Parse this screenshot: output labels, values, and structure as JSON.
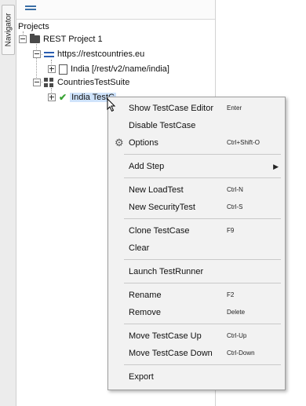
{
  "navigator": {
    "tab_label": "Navigator"
  },
  "tree": {
    "root_label": "Projects",
    "project": "REST Project 1",
    "service": "https://restcountries.eu",
    "resource": "India [/rest/v2/name/india]",
    "suite": "CountriesTestSuite",
    "testcase": "India TestC"
  },
  "menu": {
    "items": [
      {
        "label": "Show TestCase Editor",
        "shortcut": "Enter"
      },
      {
        "label": "Disable TestCase",
        "shortcut": ""
      },
      {
        "label": "Options",
        "shortcut": "Ctrl+Shift-O",
        "icon": "gear-icon"
      },
      {
        "label": "Add Step",
        "shortcut": "",
        "submenu": true
      },
      {
        "label": "New LoadTest",
        "shortcut": "Ctrl-N"
      },
      {
        "label": "New SecurityTest",
        "shortcut": "Ctrl-S"
      },
      {
        "label": "Clone TestCase",
        "shortcut": "F9"
      },
      {
        "label": "Clear",
        "shortcut": ""
      },
      {
        "label": "Launch TestRunner",
        "shortcut": ""
      },
      {
        "label": "Rename",
        "shortcut": "F2"
      },
      {
        "label": "Remove",
        "shortcut": "Delete"
      },
      {
        "label": "Move TestCase Up",
        "shortcut": "Ctrl-Up"
      },
      {
        "label": "Move TestCase Down",
        "shortcut": "Ctrl-Down"
      },
      {
        "label": "Export",
        "shortcut": ""
      }
    ]
  },
  "colors": {
    "selection": "#cfe3fb",
    "menu_bg": "#f2f2f2",
    "check": "#3aa335",
    "service_icon": "#2a5db0"
  }
}
